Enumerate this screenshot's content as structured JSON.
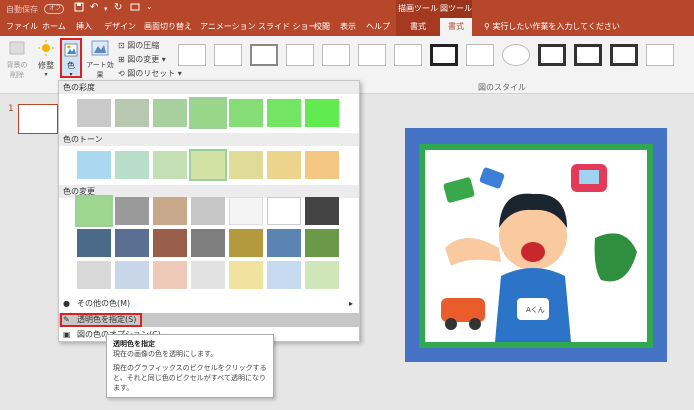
{
  "titlebar": {
    "autosave_label": "自動保存",
    "autosave_state": "オフ",
    "context_groups": [
      "描画ツール",
      "図ツール"
    ]
  },
  "tabs": [
    "ファイル",
    "ホーム",
    "挿入",
    "デザイン",
    "画面切り替え",
    "アニメーション",
    "スライド ショー",
    "校閲",
    "表示",
    "ヘルプ",
    "書式",
    "書式"
  ],
  "search": {
    "placeholder": "実行したい作業を入力してください"
  },
  "ribbon": {
    "remove_bg_label": "背景の\n削除",
    "corrections_label": "修整",
    "color_label": "色",
    "art_effects_label": "アート効果",
    "compress_label": "図の圧縮",
    "change_label": "図の変更",
    "reset_label": "図のリセット",
    "styles_group_label": "図のスタイル"
  },
  "slide": {
    "number": "1"
  },
  "panel": {
    "section1": "色の彩度",
    "section2": "色のトーン",
    "section3": "色の変更",
    "more_colors": "その他の色(M)",
    "set_transparent": "透明色を指定(S)",
    "picture_color_options": "図の色のオプション(C)..."
  },
  "tooltip": {
    "title": "透明色を指定",
    "line1": "現在の画像の色を透明にします。",
    "line2": "現在のグラフィックスのピクセルをクリックすると、それと同じ色のピクセルがすべて透明になります。"
  },
  "picture": {
    "badge": "Aくん"
  },
  "colors": {
    "accent": "#b7472a",
    "highlight_box": "#e02020",
    "picture_frame": "#4472c4",
    "picture_border_green": "#2fa84f"
  }
}
